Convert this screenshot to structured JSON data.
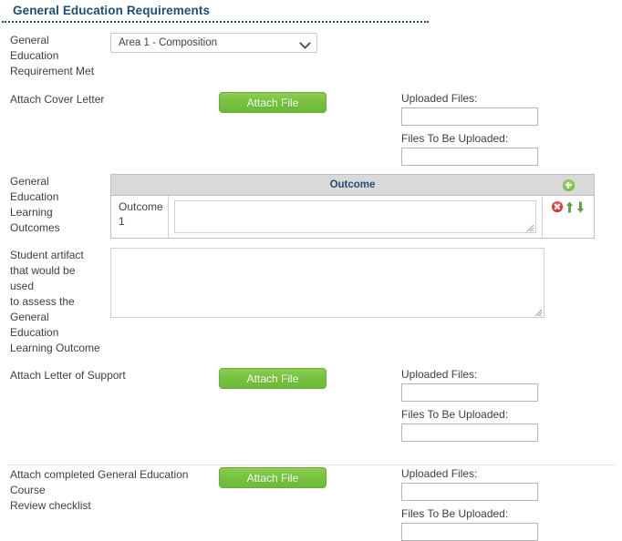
{
  "section": {
    "title": "General Education Requirements"
  },
  "requirement_met": {
    "label_line1": "General Education",
    "label_line2": "Requirement Met",
    "selected_value": "Area 1 - Composition"
  },
  "cover_letter": {
    "label": "Attach Cover Letter",
    "button_label": "Attach File",
    "uploaded_files_label": "Uploaded Files:",
    "uploaded_files_value": "",
    "files_to_upload_label": "Files To Be Uploaded:",
    "files_to_upload_value": ""
  },
  "learning_outcomes": {
    "label_line1": "General Education",
    "label_line2": "Learning Outcomes",
    "column_header": "Outcome",
    "add_icon": "add-circle-icon",
    "rows": [
      {
        "number_line1": "Outcome",
        "number_line2": "1",
        "text_value": "",
        "delete_icon": "delete-circle-icon",
        "move_up_icon": "arrow-up-icon",
        "move_down_icon": "arrow-down-icon"
      }
    ]
  },
  "student_artifact": {
    "label_line1": "Student artifact",
    "label_line2": "that would be used",
    "label_line3": "to assess the",
    "label_line4": "General Education",
    "label_line5": "Learning Outcome",
    "text_value": ""
  },
  "letter_of_support": {
    "label": "Attach Letter of Support",
    "button_label": "Attach File",
    "uploaded_files_label": "Uploaded Files:",
    "uploaded_files_value": "",
    "files_to_upload_label": "Files To Be Uploaded:",
    "files_to_upload_value": ""
  },
  "course_review_checklist": {
    "label_line1": "Attach completed General Education Course",
    "label_line2": "Review checklist",
    "button_label": "Attach File",
    "uploaded_files_label": "Uploaded Files:",
    "uploaded_files_value": "",
    "files_to_upload_label": "Files To Be Uploaded:",
    "files_to_upload_value": ""
  },
  "colors": {
    "title_blue": "#1f4e79",
    "button_green": "#76c23f",
    "header_gray": "#d9d9d9",
    "delete_red": "#e02b2b",
    "arrow_green": "#5aa832"
  }
}
